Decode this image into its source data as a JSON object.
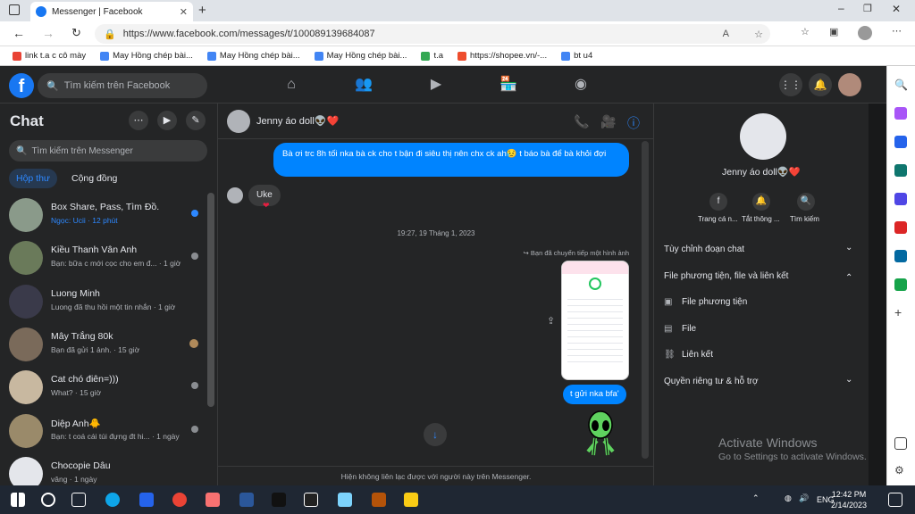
{
  "browser": {
    "tab_title": "Messenger | Facebook",
    "url": "https://www.facebook.com/messages/t/100089139684087",
    "bookmarks": [
      {
        "label": "link t.a c cô mày",
        "color": "#e94335"
      },
      {
        "label": "May Hồng chép bài...",
        "color": "#4285f4"
      },
      {
        "label": "May Hồng chép bài...",
        "color": "#4285f4"
      },
      {
        "label": "May Hồng chép bài...",
        "color": "#4285f4"
      },
      {
        "label": "t.a",
        "color": "#34a853"
      },
      {
        "label": "https://shopee.vn/-...",
        "color": "#ee4d2d"
      },
      {
        "label": "bt u4",
        "color": "#4285f4"
      }
    ]
  },
  "facebook": {
    "search_placeholder": "Tìm kiếm trên Facebook"
  },
  "chat_list": {
    "title": "Chat",
    "search_placeholder": "Tìm kiếm trên Messenger",
    "tab_inbox": "Hộp thư",
    "tab_community": "Cộng đồng",
    "conversations": [
      {
        "name": "Box Share, Pass, Tìm Đồ.",
        "preview": "Ngọc: Ucii · 12 phút",
        "avatar": "#8a9a8a",
        "mark": "#2d88ff"
      },
      {
        "name": "Kiều Thanh Vân Anh",
        "preview": "Bạn: bữa c mới cọc cho em đ... · 1 giờ",
        "avatar": "#6a7a5a",
        "mark": "#8a8d91"
      },
      {
        "name": "Luong Minh",
        "preview": "Luong đã thu hồi một tin nhắn · 1 giờ",
        "avatar": "#3a3a4a",
        "mark": "#8a8d91"
      },
      {
        "name": "Mây Trắng 80k",
        "preview": "Bạn đã gửi 1 ảnh. · 15 giờ",
        "avatar": "#7a6a5a",
        "mark": "#b08a5a"
      },
      {
        "name": "Cat chó điên=)))",
        "preview": "What? · 15 giờ",
        "avatar": "#c8b8a0",
        "mark": "#8a8d91"
      },
      {
        "name": "Diệp Anh🐥",
        "preview": "Bạn: t coá cái túi đựng đt hi... · 1 ngày",
        "avatar": "#9a8a6a",
        "mark": "#8a8d91"
      },
      {
        "name": "Chocopie Dâu",
        "preview": "vâng · 1 ngày",
        "avatar": "#e4e6eb",
        "mark": ""
      }
    ]
  },
  "conversation": {
    "name": "Jenny áo doll👽❤️",
    "outgoing_message": "Bà ơi trc 8h tối nka bà ck cho t bận đi siêu thị nên chx ck ah😥 t báo bà để bà khỏi đợi",
    "incoming_message": "Uke",
    "timestamp": "19:27, 19 Tháng 1, 2023",
    "forward_note": "Bạn đã chuyển tiếp một hình ảnh",
    "image_reply": "t gửi nka bfa'",
    "footer": "Hiện không liên lạc được với người này trên Messenger."
  },
  "right_panel": {
    "name": "Jenny áo doll👽❤️",
    "actions": [
      "Trang cá n...",
      "Tắt thông ...",
      "Tìm kiếm"
    ],
    "sections": [
      {
        "label": "Tùy chỉnh đoạn chat",
        "chevron": "⌄"
      },
      {
        "label": "File phương tiện, file và liên kết",
        "chevron": "⌃"
      }
    ],
    "items": [
      {
        "label": "File phương tiện",
        "icon": "image-icon"
      },
      {
        "label": "File",
        "icon": "file-icon"
      },
      {
        "label": "Liên kết",
        "icon": "link-icon"
      }
    ],
    "privacy": "Quyền riêng tư & hỗ trợ"
  },
  "activate_windows": {
    "title": "Activate Windows",
    "subtitle": "Go to Settings to activate Windows."
  },
  "taskbar": {
    "language": "ENG",
    "time": "12:42 PM",
    "date": "2/14/2023"
  }
}
